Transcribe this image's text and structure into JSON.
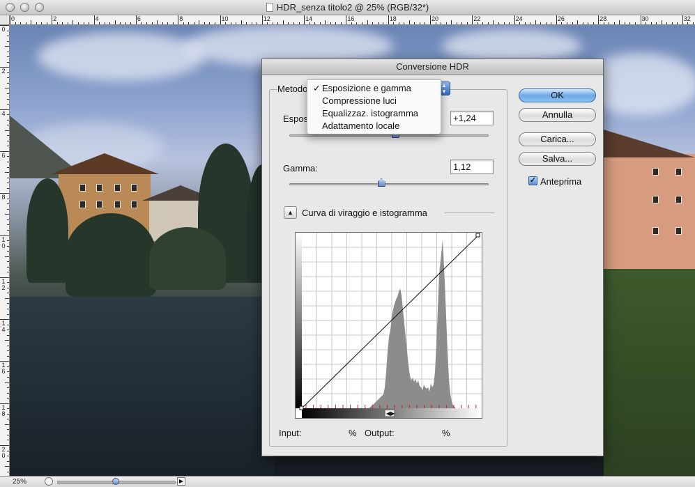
{
  "window": {
    "title": "HDR_senza titolo2 @ 25% (RGB/32*)"
  },
  "ruler_top_labels": [
    "0",
    "2",
    "4",
    "6",
    "8",
    "10",
    "12",
    "14",
    "16",
    "18",
    "20",
    "22",
    "24",
    "26",
    "28",
    "30",
    "32"
  ],
  "ruler_left_labels": [
    "0",
    "2",
    "4",
    "6",
    "8",
    "1 0",
    "1 2",
    "1 4",
    "1 6",
    "1 8",
    "2 0"
  ],
  "status": {
    "zoom": "25%"
  },
  "dialog": {
    "title": "Conversione HDR",
    "method_label": "Metodo",
    "exposure_label": "Esposizione",
    "exposure_value": "+1,24",
    "gamma_label": "Gamma:",
    "gamma_value": "1,12",
    "curve_section_label": "Curva di viraggio e istogramma",
    "input_label": "Input:",
    "input_unit": "%",
    "output_label": "Output:",
    "output_unit": "%",
    "buttons": {
      "ok": "OK",
      "cancel": "Annulla",
      "load": "Carica...",
      "save": "Salva..."
    },
    "preview_label": "Anteprima",
    "preview_checked": true
  },
  "method_menu": {
    "items": [
      {
        "label": "Esposizione e gamma",
        "checked": true
      },
      {
        "label": "Compressione luci",
        "checked": false
      },
      {
        "label": "Equalizzaz. istogramma",
        "checked": false
      },
      {
        "label": "Adattamento locale",
        "checked": false
      }
    ],
    "check_glyph": "✓"
  },
  "colors": {
    "accent": "#5b8dce",
    "histogram": "#8c8c8c",
    "tick_marks": "#cc2222"
  },
  "slider_levels": {
    "exposure_fraction": 0.53,
    "gamma_fraction": 0.46,
    "zoom_fraction": 0.5
  }
}
